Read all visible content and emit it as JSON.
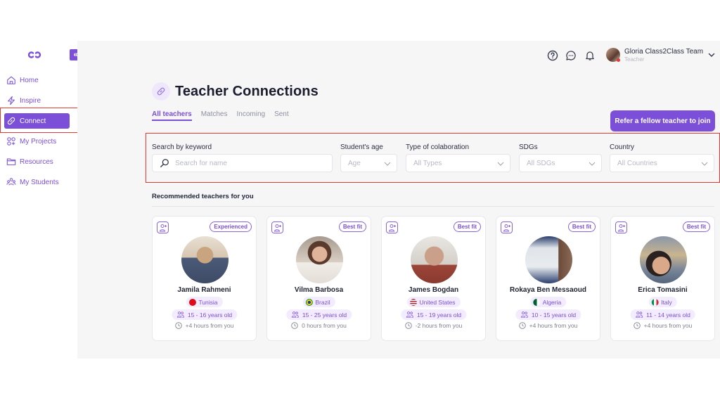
{
  "sidebar": {
    "logo": "class2class-logo-icon",
    "collapse_icon": "double-chevron-left-icon",
    "items": [
      {
        "label": "Home",
        "icon": "home-icon",
        "active": false
      },
      {
        "label": "Inspire",
        "icon": "lightning-icon",
        "active": false
      },
      {
        "label": "Connect",
        "icon": "link-icon",
        "active": true
      },
      {
        "label": "My Projects",
        "icon": "projects-icon",
        "active": false
      },
      {
        "label": "Resources",
        "icon": "folder-icon",
        "active": false
      },
      {
        "label": "My Students",
        "icon": "students-icon",
        "active": false
      }
    ]
  },
  "topbar": {
    "icons": [
      "help-icon",
      "chat-icon",
      "bell-icon"
    ],
    "user": {
      "name": "Gloria Class2Class Team",
      "role": "Teacher",
      "status_color": "#e53935"
    }
  },
  "header": {
    "title": "Teacher Connections",
    "icon": "link-icon",
    "tabs": [
      {
        "label": "All teachers",
        "active": true
      },
      {
        "label": "Matches",
        "active": false
      },
      {
        "label": "Incoming",
        "active": false
      },
      {
        "label": "Sent",
        "active": false
      }
    ],
    "refer_button": "Refer a fellow teacher to join"
  },
  "filters": {
    "keyword": {
      "label": "Search by keyword",
      "placeholder": "Search for name",
      "value": ""
    },
    "age": {
      "label": "Student's age",
      "value": "Age"
    },
    "collab": {
      "label": "Type of colaboration",
      "value": "All Types"
    },
    "sdgs": {
      "label": "SDGs",
      "value": "All SDGs"
    },
    "country": {
      "label": "Country",
      "value": "All Countries"
    }
  },
  "recommended": {
    "title": "Recommended teachers for you",
    "teachers": [
      {
        "name": "Jamila Rahmeni",
        "badge": "Experienced",
        "country": "Tunisia",
        "age": "15 - 16 years old",
        "timezone": "+4 hours from you"
      },
      {
        "name": "Vilma Barbosa",
        "badge": "Best fit",
        "country": "Brazil",
        "age": "15 - 25 years old",
        "timezone": "0 hours from you"
      },
      {
        "name": "James Bogdan",
        "badge": "Best fit",
        "country": "United States",
        "age": "15 - 19 years old",
        "timezone": "-2 hours from you"
      },
      {
        "name": "Rokaya Ben Messaoud",
        "badge": "Best fit",
        "country": "Algeria",
        "age": "10 - 15 years old",
        "timezone": "+4 hours from you"
      },
      {
        "name": "Erica Tomasini",
        "badge": "Best fit",
        "country": "Italy",
        "age": "11 - 14 years old",
        "timezone": "+4 hours from you"
      }
    ]
  },
  "colors": {
    "accent": "#7b4fd8",
    "accent_light": "#f3ecfe",
    "highlight_border": "#e53935",
    "background": "#f6f6f7"
  }
}
